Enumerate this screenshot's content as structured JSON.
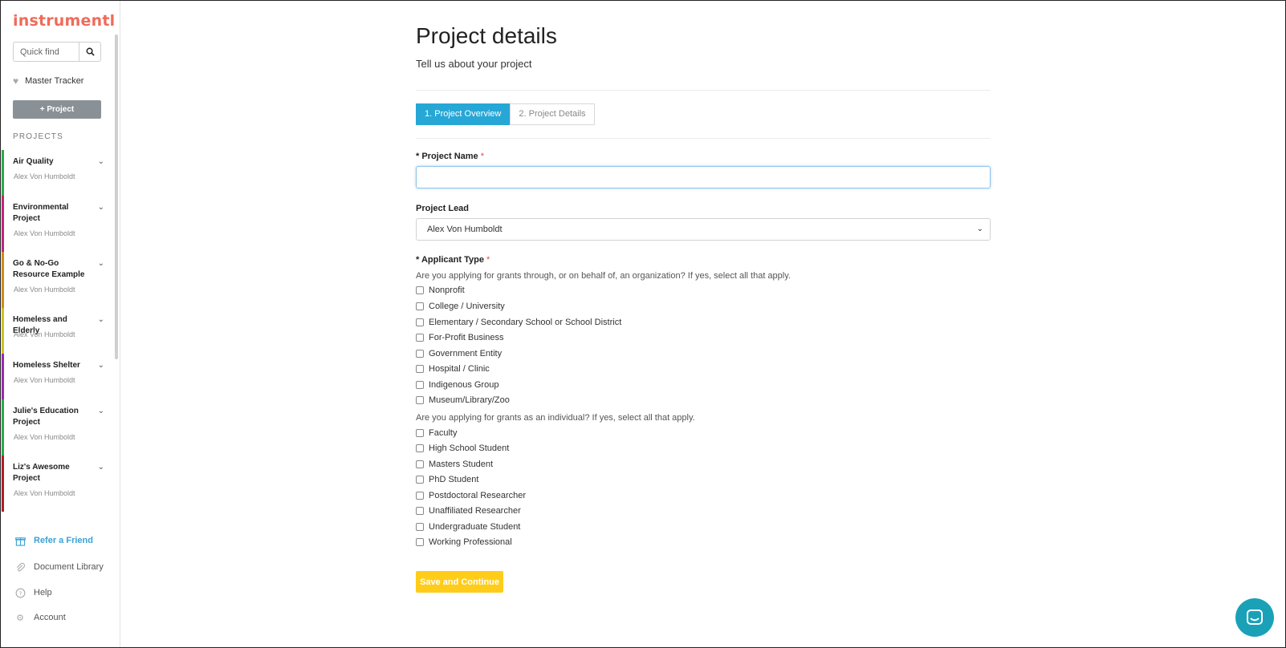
{
  "app": {
    "logo": "instrumentl",
    "brand_color": "#ef6b5a",
    "accent_color": "#27a7d6"
  },
  "sidebar": {
    "search": {
      "placeholder": "Quick find",
      "icon": "search-icon"
    },
    "master_tracker": {
      "label": "Master Tracker",
      "icon": "heart-icon"
    },
    "add_project_label": "+ Project",
    "projects_heading": "PROJECTS",
    "projects": [
      {
        "name": "Air Quality",
        "lead": "Alex Von Humboldt",
        "color": "#2aa84a"
      },
      {
        "name": "Environmental Project",
        "lead": "Alex Von Humboldt",
        "color": "#c0267a"
      },
      {
        "name": "Go & No-Go Resource Example",
        "lead": "Alex Von Humboldt",
        "color": "#d18a1a"
      },
      {
        "name": "Homeless and Elderly",
        "lead": "Alex Von Humboldt",
        "color": "#c9c423"
      },
      {
        "name": "Homeless Shelter",
        "lead": "Alex Von Humboldt",
        "color": "#9a2bb0"
      },
      {
        "name": "Julie's Education Project",
        "lead": "Alex Von Humboldt",
        "color": "#2aa84a"
      },
      {
        "name": "Liz's Awesome Project",
        "lead": "Alex Von Humboldt",
        "color": "#b01e2a"
      }
    ],
    "bottom_links": [
      {
        "label": "Refer a Friend",
        "icon": "gift-icon"
      },
      {
        "label": "Document Library",
        "icon": "paperclip-icon"
      },
      {
        "label": "Help",
        "icon": "help-icon"
      },
      {
        "label": "Account",
        "icon": "gear-icon"
      }
    ]
  },
  "main": {
    "title": "Project details",
    "subtitle": "Tell us about your project",
    "tabs": [
      {
        "label": "1. Project Overview",
        "active": true
      },
      {
        "label": "2. Project Details",
        "active": false
      }
    ],
    "project_name": {
      "label": "Project Name",
      "marker": "*",
      "value": ""
    },
    "project_lead": {
      "label": "Project Lead",
      "value": "Alex Von Humboldt"
    },
    "applicant_type": {
      "label": "Applicant Type",
      "marker": "*",
      "org_help": "Are you applying for grants through, or on behalf of, an organization? If yes, select all that apply.",
      "org_options": [
        "Nonprofit",
        "College / University",
        "Elementary / Secondary School or School District",
        "For-Profit Business",
        "Government Entity",
        "Hospital / Clinic",
        "Indigenous Group",
        "Museum/Library/Zoo"
      ],
      "individual_help": "Are you applying for grants as an individual? If yes, select all that apply.",
      "individual_options": [
        "Faculty",
        "High School Student",
        "Masters Student",
        "PhD Student",
        "Postdoctoral Researcher",
        "Unaffiliated Researcher",
        "Undergraduate Student",
        "Working Professional"
      ]
    },
    "save_label": "Save and Continue",
    "save_color": "#ffcc1a"
  },
  "chat": {
    "icon": "chat-icon",
    "color": "#1aa1b8"
  }
}
